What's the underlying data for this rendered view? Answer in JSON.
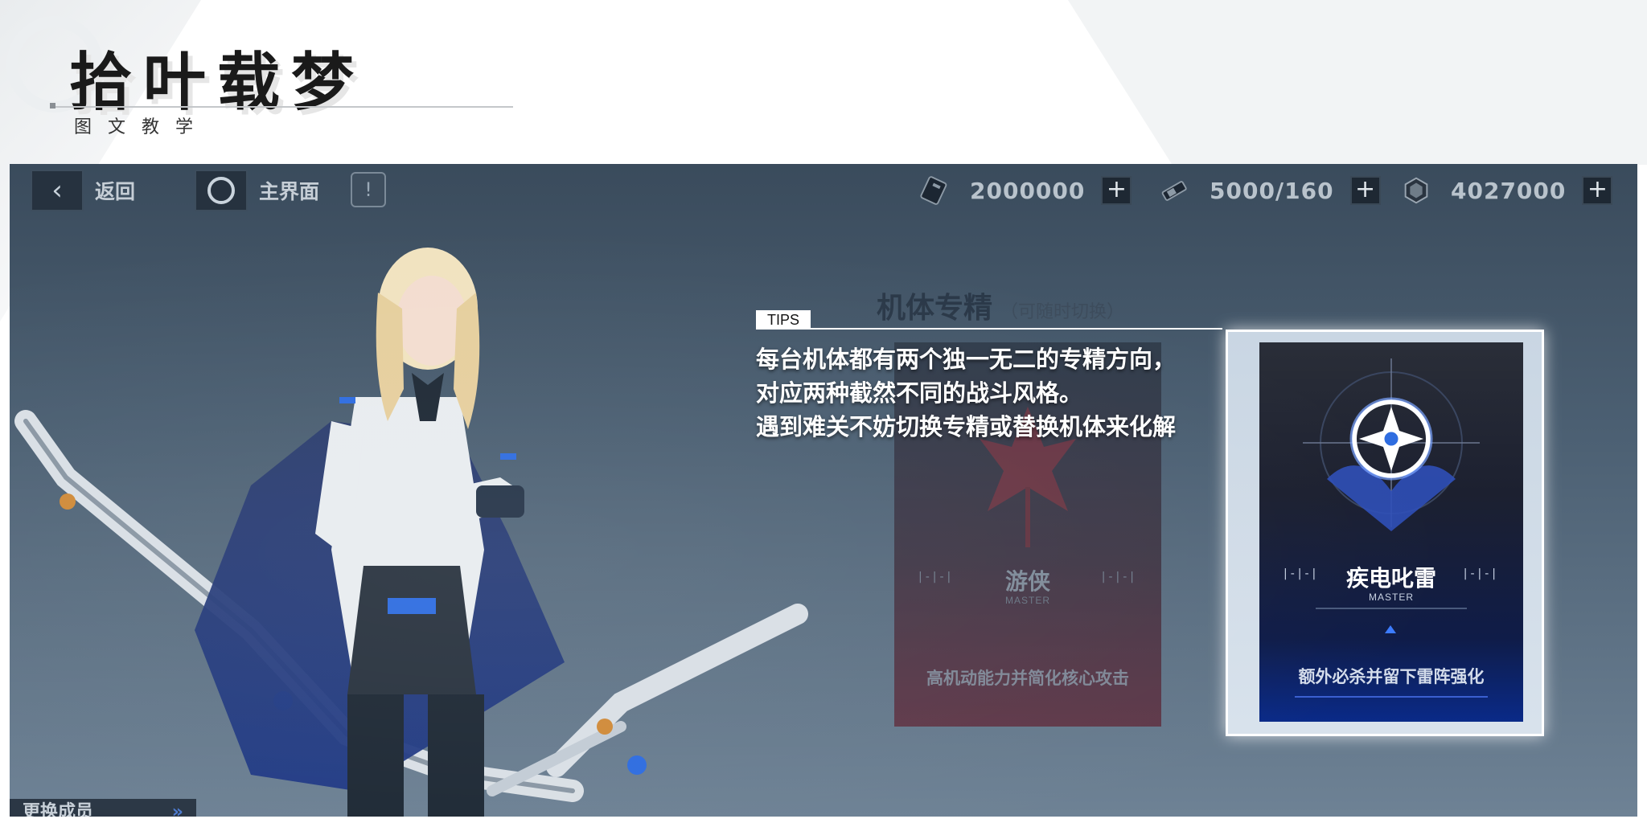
{
  "slide": {
    "title": "拾叶载梦",
    "subtitle": "图文教学"
  },
  "topbar": {
    "back_label": "返回",
    "home_label": "主界面",
    "currencies": [
      {
        "icon": "ticket-icon",
        "value": "2000000"
      },
      {
        "icon": "battery-icon",
        "value": "5000/160"
      },
      {
        "icon": "crystal-icon",
        "value": "4027000"
      }
    ],
    "plus_symbol": "+"
  },
  "section": {
    "title": "机体专精",
    "hint": "（可随时切换）"
  },
  "tips": {
    "label": "TIPS",
    "lines": [
      "每台机体都有两个独一无二的专精方向，",
      "对应两种截然不同的战斗风格。",
      "遇到难关不妨切换专精或替换机体来化解"
    ]
  },
  "cards": [
    {
      "name": "游侠",
      "rank": "MASTER",
      "description": "高机动能力并简化核心攻击"
    },
    {
      "name": "疾电叱雷",
      "rank": "MASTER",
      "description": "额外必杀并留下雷阵强化"
    }
  ],
  "bottom_button": {
    "label": "更换成员",
    "arrows": "»"
  },
  "colors": {
    "accent_blue": "#2f6de0",
    "ranger_red": "#8a2a3a",
    "screen_bg": "#4b5f72"
  }
}
